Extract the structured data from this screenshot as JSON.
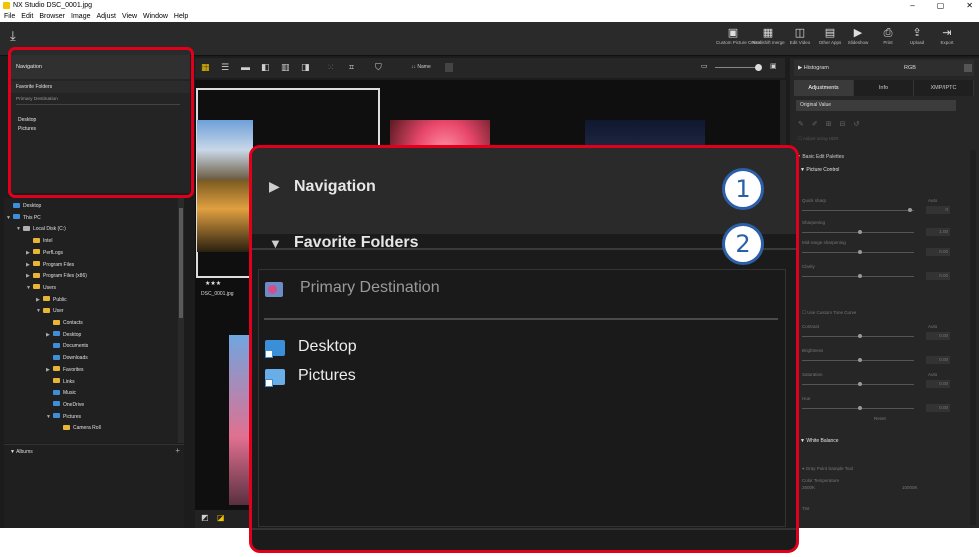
{
  "window": {
    "title": "NX Studio   DSC_0001.jpg",
    "minimize": "–",
    "maximize": "▢",
    "close": "✕"
  },
  "menu": [
    "File",
    "Edit",
    "Browser",
    "Image",
    "Adjust",
    "View",
    "Window",
    "Help"
  ],
  "toolbar": {
    "buttons": [
      {
        "icon": "▣",
        "label": "Custom Picture Control"
      },
      {
        "icon": "▦",
        "label": "Pixel shift merge"
      },
      {
        "icon": "◫",
        "label": "Edit Video"
      },
      {
        "icon": "▤",
        "label": "Other Apps"
      },
      {
        "icon": "▶",
        "label": "Slideshow"
      },
      {
        "icon": "⎙",
        "label": "Print"
      },
      {
        "icon": "⇪",
        "label": "Upload"
      },
      {
        "icon": "⇥",
        "label": "Export"
      }
    ]
  },
  "left_panel": {
    "navigation": "Navigation",
    "favorite_folders": "Favorite Folders",
    "primary_destination": "Primary Destination",
    "items": [
      "Desktop",
      "Pictures"
    ]
  },
  "tree": {
    "rows": [
      {
        "label": "Desktop",
        "indent": 0,
        "arrow": "",
        "color": "blue"
      },
      {
        "label": "This PC",
        "indent": 0,
        "arrow": "▼",
        "color": "blue"
      },
      {
        "label": "Local Disk (C:)",
        "indent": 1,
        "arrow": "▼",
        "color": "gray"
      },
      {
        "label": "Intel",
        "indent": 2,
        "arrow": "",
        "color": "yellow"
      },
      {
        "label": "PerfLogs",
        "indent": 2,
        "arrow": "▶",
        "color": "yellow"
      },
      {
        "label": "Program Files",
        "indent": 2,
        "arrow": "▶",
        "color": "yellow"
      },
      {
        "label": "Program Files (x86)",
        "indent": 2,
        "arrow": "▶",
        "color": "yellow"
      },
      {
        "label": "Users",
        "indent": 2,
        "arrow": "▼",
        "color": "yellow"
      },
      {
        "label": "Public",
        "indent": 3,
        "arrow": "▶",
        "color": "yellow"
      },
      {
        "label": "User",
        "indent": 3,
        "arrow": "▼",
        "color": "yellow"
      },
      {
        "label": "Contacts",
        "indent": 4,
        "arrow": "",
        "color": "yellow"
      },
      {
        "label": "Desktop",
        "indent": 4,
        "arrow": "▶",
        "color": "blue"
      },
      {
        "label": "Documents",
        "indent": 4,
        "arrow": "",
        "color": "blue"
      },
      {
        "label": "Downloads",
        "indent": 4,
        "arrow": "",
        "color": "blue"
      },
      {
        "label": "Favorites",
        "indent": 4,
        "arrow": "▶",
        "color": "yellow"
      },
      {
        "label": "Links",
        "indent": 4,
        "arrow": "",
        "color": "yellow"
      },
      {
        "label": "Music",
        "indent": 4,
        "arrow": "",
        "color": "blue"
      },
      {
        "label": "OneDrive",
        "indent": 4,
        "arrow": "",
        "color": "blue"
      },
      {
        "label": "Pictures",
        "indent": 4,
        "arrow": "▼",
        "color": "blue"
      },
      {
        "label": "Camera Roll",
        "indent": 5,
        "arrow": "",
        "color": "yellow"
      }
    ]
  },
  "albums": {
    "label": "Albums",
    "add": "+"
  },
  "browser": {
    "sort_label": "↓↓ Name",
    "rating": "★★★",
    "file_name": "DSC_0001.jpg"
  },
  "right_panel": {
    "histogram": "Histogram",
    "histogram_mode": "RGB",
    "tabs": [
      "Adjustments",
      "Info",
      "XMP/IPTC"
    ],
    "preset": "Original Value",
    "hdr": "Adjust using HDR",
    "basic": "Basic Edit Palettes",
    "picture_control": "Picture Control",
    "rows": [
      {
        "label": "Quick sharp",
        "value": "0"
      },
      {
        "label": "Sharpening",
        "value": "1.00"
      },
      {
        "label": "Mid-range sharpening",
        "value": "0.00"
      },
      {
        "label": "Clarity",
        "value": "0.00"
      },
      {
        "label": "Contrast",
        "value": "0.00"
      },
      {
        "label": "Brightness",
        "value": "0.00"
      },
      {
        "label": "Saturation",
        "value": "0.00"
      },
      {
        "label": "Hue",
        "value": "0.00"
      }
    ],
    "auto": "Auto",
    "use_custom_tone": "Use Custom Tone Curve",
    "reset": "Reset",
    "white_balance": "White Balance",
    "gray_point": "Gray Point Sample Tool",
    "color_temp": "Color Temperature",
    "color_temp_min": "2500K",
    "color_temp_max": "10000K",
    "tint": "Tint"
  },
  "callout": {
    "navigation": "Navigation",
    "favorite_folders": "Favorite Folders",
    "primary_destination": "Primary Destination",
    "items": [
      "Desktop",
      "Pictures"
    ],
    "badges": [
      "1",
      "2"
    ],
    "colors": {
      "highlight": "#e0001b",
      "badge": "#2b5fa8"
    }
  }
}
